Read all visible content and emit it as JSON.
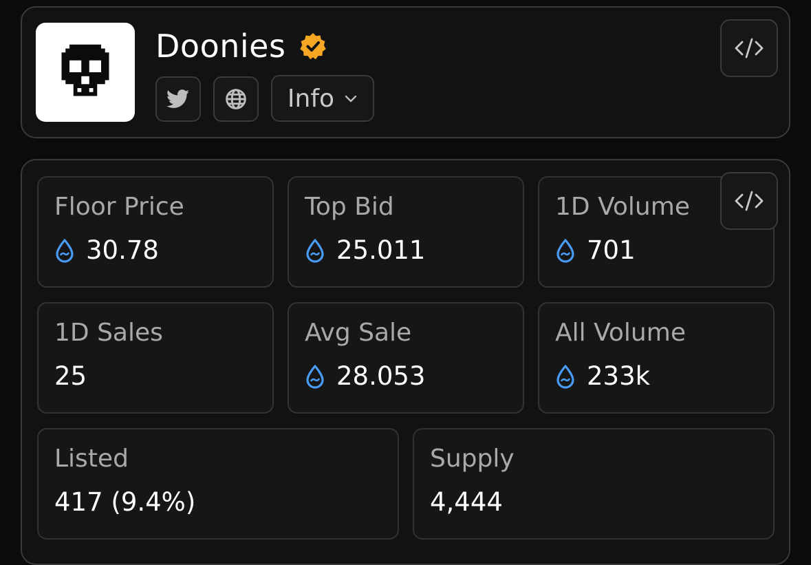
{
  "collection": {
    "name": "Doonies",
    "info_label": "Info"
  },
  "icons": {
    "logo": "skull-icon",
    "verified": "verified-badge-icon",
    "twitter": "twitter-icon",
    "website": "globe-icon",
    "embed": "code-icon",
    "currency": "sui-drop-icon"
  },
  "colors": {
    "verified": "#f5a623",
    "currency": "#4a9bf5"
  },
  "stats": [
    {
      "label": "Floor Price",
      "value": "30.78"
    },
    {
      "label": "Top Bid",
      "value": "25.011"
    },
    {
      "label": "1D Volume",
      "value": "701"
    },
    {
      "label": "1D Sales",
      "value": "25"
    },
    {
      "label": "Avg Sale",
      "value": "28.053"
    },
    {
      "label": "All Volume",
      "value": "233k"
    },
    {
      "label": "Listed",
      "value": "417 (9.4%)"
    },
    {
      "label": "Supply",
      "value": "4,444"
    }
  ]
}
